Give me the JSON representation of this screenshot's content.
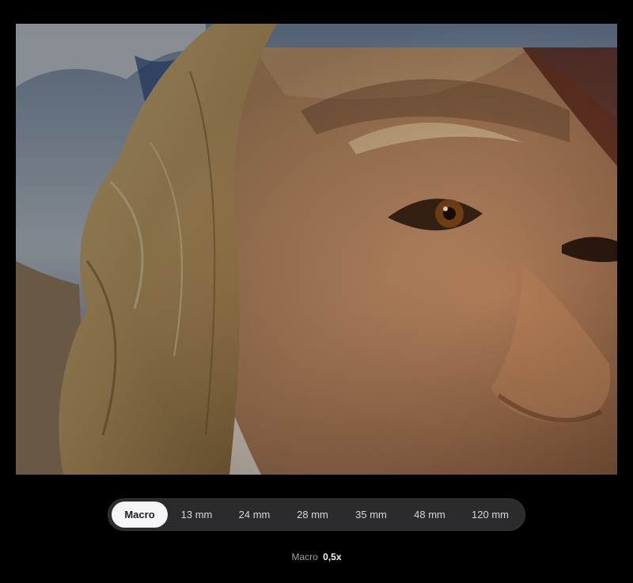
{
  "photo": {
    "subject": "close-up-portrait"
  },
  "lens_selector": {
    "items": [
      {
        "label": "Macro",
        "selected": true
      },
      {
        "label": "13 mm",
        "selected": false
      },
      {
        "label": "24 mm",
        "selected": false
      },
      {
        "label": "28 mm",
        "selected": false
      },
      {
        "label": "35 mm",
        "selected": false
      },
      {
        "label": "48 mm",
        "selected": false
      },
      {
        "label": "120 mm",
        "selected": false
      }
    ]
  },
  "caption": {
    "mode": "Macro",
    "zoom": "0,5x"
  },
  "colors": {
    "background": "#000000",
    "bar": "#2b2b2e",
    "active_pill": "#f5f5f7",
    "text": "#d6d6d8"
  }
}
